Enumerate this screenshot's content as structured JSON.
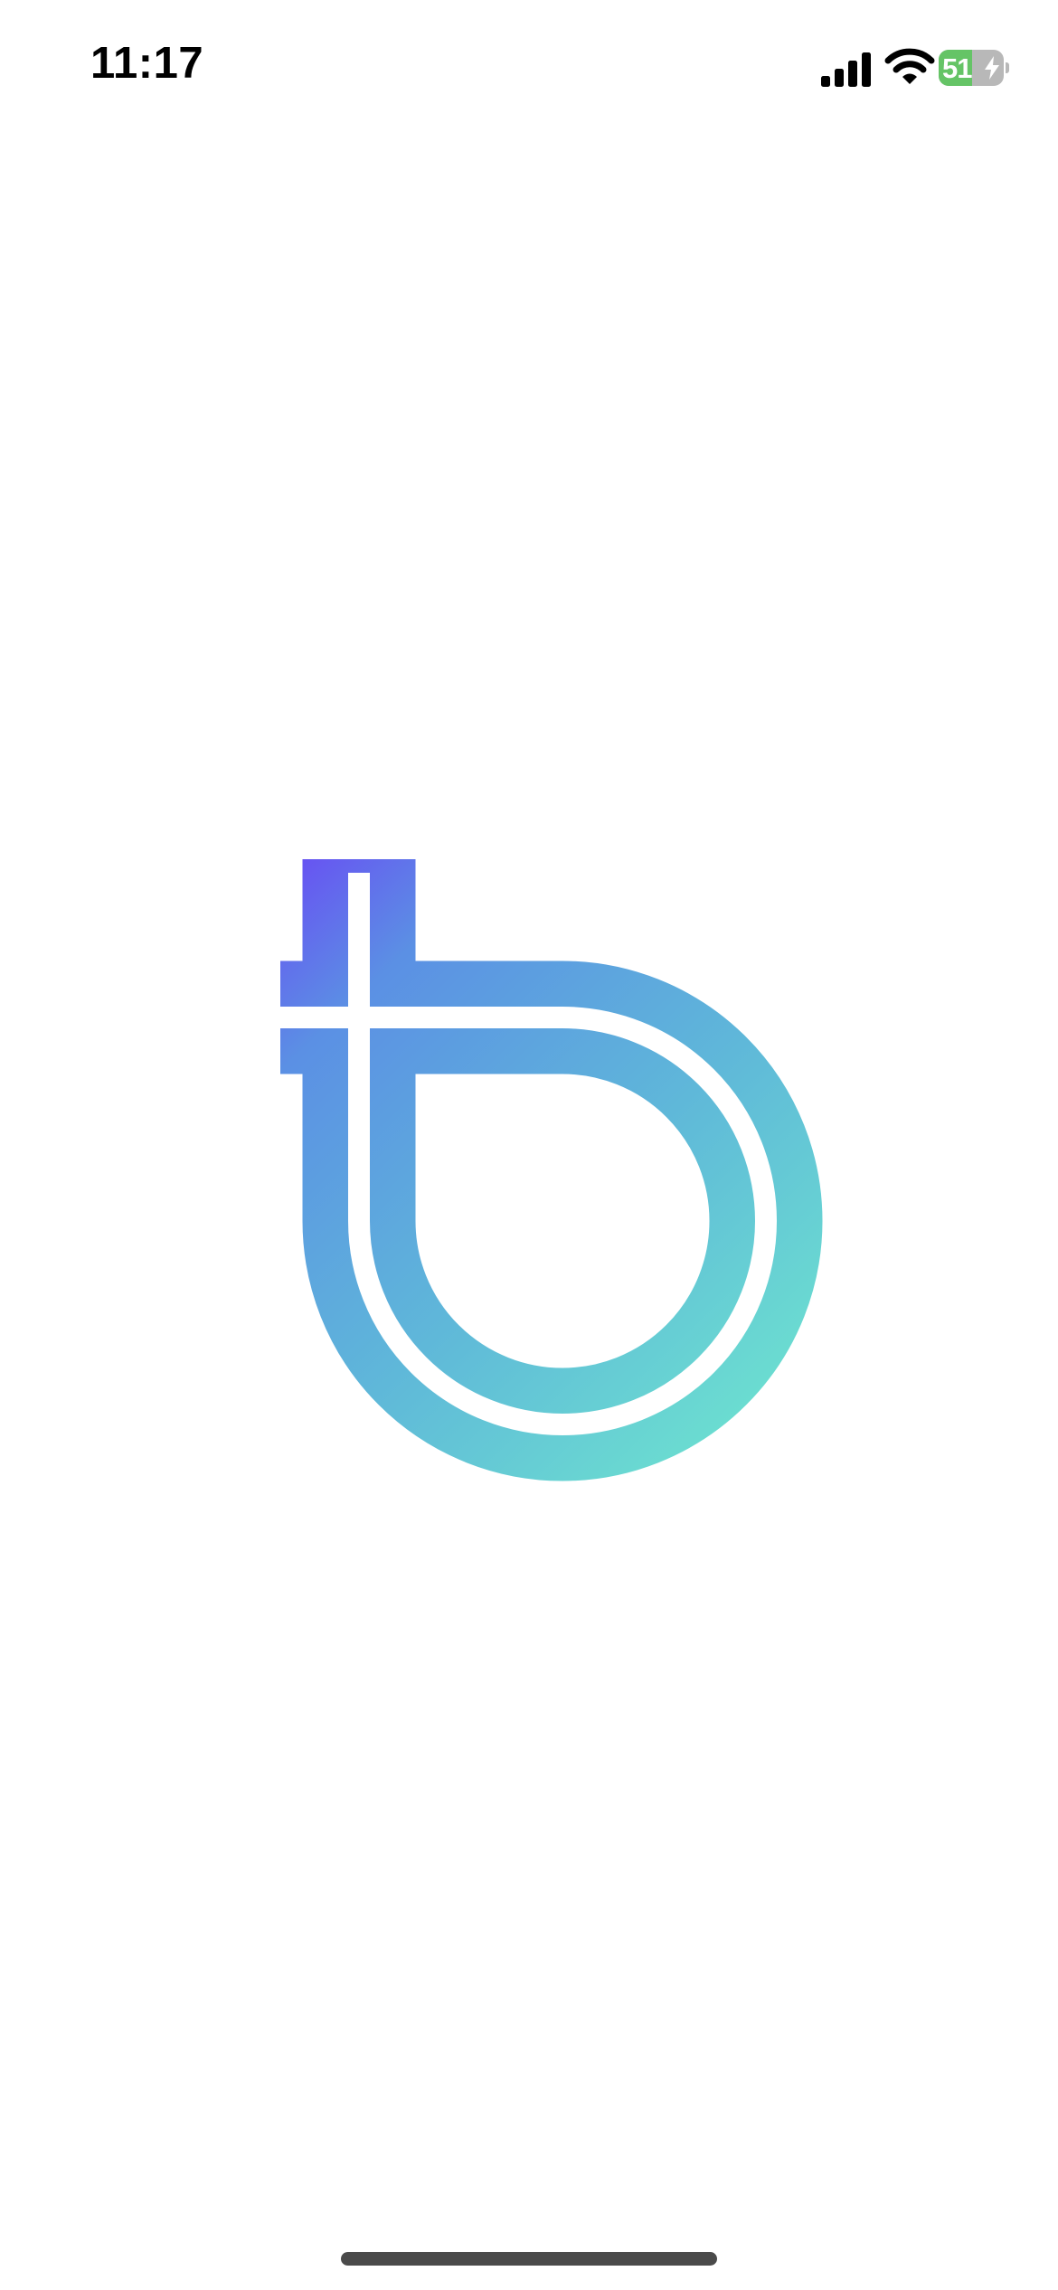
{
  "status_bar": {
    "time": "11:17",
    "battery_level": "51",
    "battery_percent": 51,
    "charging": true,
    "signal_icon": "cellular-signal-icon",
    "wifi_icon": "wifi-icon",
    "battery_color": "#65c466"
  },
  "splash": {
    "logo_icon": "app-logo-icon",
    "gradient_start": "#6a45f5",
    "gradient_end": "#6de3cf"
  }
}
